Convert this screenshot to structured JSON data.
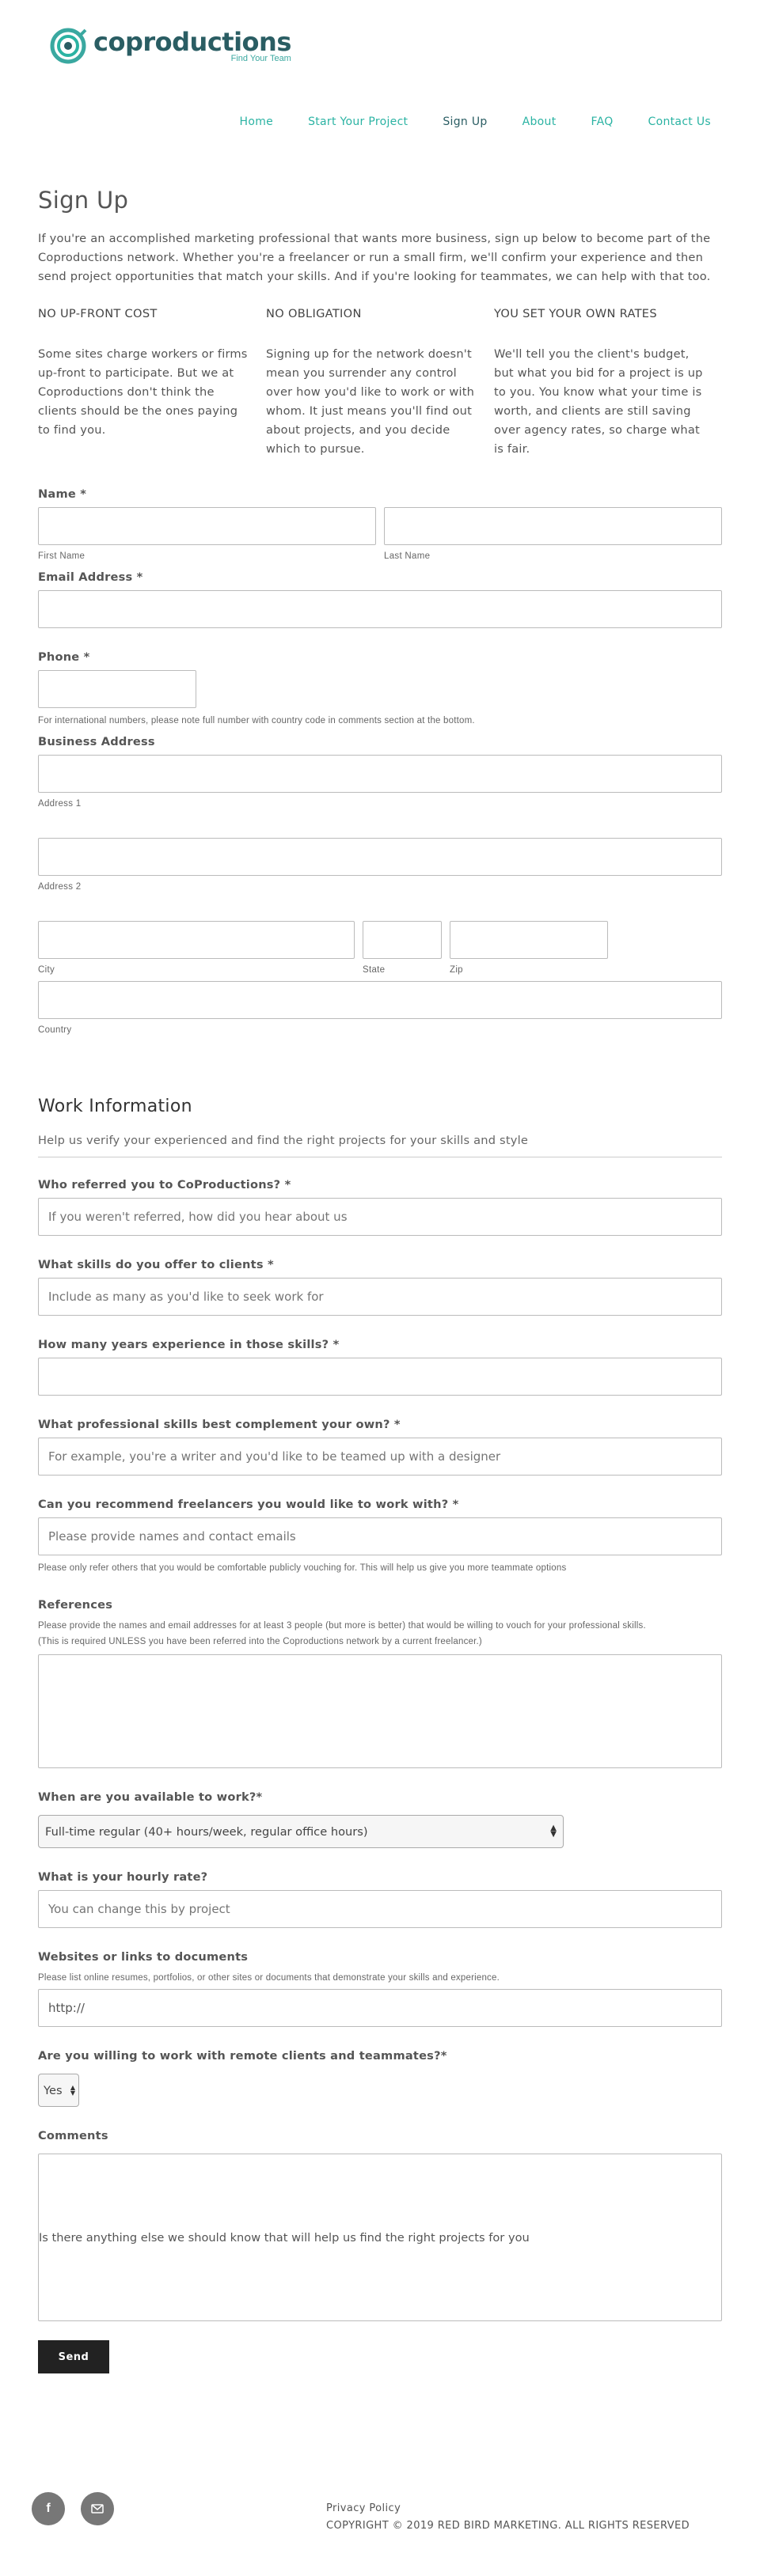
{
  "brand": {
    "name": "coproductions",
    "tagline": "Find Your Team",
    "colors": {
      "teal": "#2bb3a3",
      "dark_teal": "#2a5d63"
    }
  },
  "nav": {
    "items": [
      "Home",
      "Start Your Project",
      "Sign Up",
      "About",
      "FAQ",
      "Contact Us"
    ],
    "active": "Sign Up"
  },
  "page": {
    "title": "Sign Up",
    "intro": "If you're an accomplished marketing professional that wants more business, sign up below to become part of the Coproductions network. Whether you're a freelancer or run a small firm, we'll confirm your experience and then send project opportunities that match your skills. And if you're looking for teammates, we can help with that too.",
    "columns": [
      {
        "title": "NO UP-FRONT COST",
        "text": "Some sites charge workers or firms up-front to participate. But we at Coproductions don't think the clients should be the ones paying to find you."
      },
      {
        "title": "NO OBLIGATION",
        "text": "Signing up for the network doesn't mean you surrender any control over how you'd like to work or with whom. It just means you'll find out about projects, and you decide which to pursue."
      },
      {
        "title": "YOU SET YOUR OWN RATES",
        "text": "We'll tell you the client's budget, but what you bid for a project is up to you. You know what your time is worth, and clients are still saving over agency rates, so charge what is fair."
      }
    ]
  },
  "form": {
    "name_label": "Name *",
    "first_name": "First Name",
    "last_name": "Last Name",
    "email_label": "Email Address *",
    "phone_label": "Phone *",
    "phone_hint": "For international numbers, please note full number with country code in comments section at the bottom.",
    "address_label": "Business Address",
    "address1": "Address 1",
    "address2": "Address 2",
    "city": "City",
    "state": "State",
    "zip": "Zip",
    "country": "Country"
  },
  "work": {
    "title": "Work Information",
    "subtitle": "Help us verify your experienced and find the right projects for your skills and style",
    "referred_label": "Who referred you to CoProductions? *",
    "referred_placeholder": "If you weren't referred, how did you hear about us",
    "skills_label": "What skills do you offer to clients *",
    "skills_placeholder": "Include as many as you'd like to seek work for",
    "years_label": "How many years experience in those skills? *",
    "complement_label": "What professional skills best complement your own? *",
    "complement_placeholder": "For example, you're a writer and you'd like to be teamed up with a designer",
    "recommend_label": "Can you recommend freelancers you would like to work with? *",
    "recommend_placeholder": "Please provide names and contact emails",
    "recommend_hint": "Please only refer others that you would be comfortable publicly vouching for. This will help us give you more teammate options",
    "references_label": "References",
    "references_hint1": "Please provide the names and email addresses for at least 3 people (but more is better) that would be willing to vouch for your professional skills.",
    "references_hint2": "(This is required UNLESS you have been referred into the Coproductions network by a current freelancer.)",
    "available_label": "When are you available to work?*",
    "available_value": "Full-time regular (40+ hours/week, regular office hours)",
    "rate_label": "What is your hourly rate?",
    "rate_placeholder": "You can change this by project",
    "websites_label": "Websites or links to documents",
    "websites_hint": "Please list online resumes, portfolios, or other sites or documents that demonstrate your skills and experience.",
    "websites_value": "http://",
    "remote_label": "Are you willing to work with remote clients and teammates?*",
    "remote_value": "Yes",
    "comments_label": "Comments",
    "comments_placeholder": "Is there anything else we should know that will help us find the right projects for you",
    "send_label": "Send"
  },
  "footer": {
    "privacy": "Privacy Policy",
    "copyright": "COPYRIGHT © 2019 RED BIRD MARKETING. ALL RIGHTS RESERVED",
    "social_icons": [
      "facebook-icon",
      "email-icon"
    ]
  }
}
